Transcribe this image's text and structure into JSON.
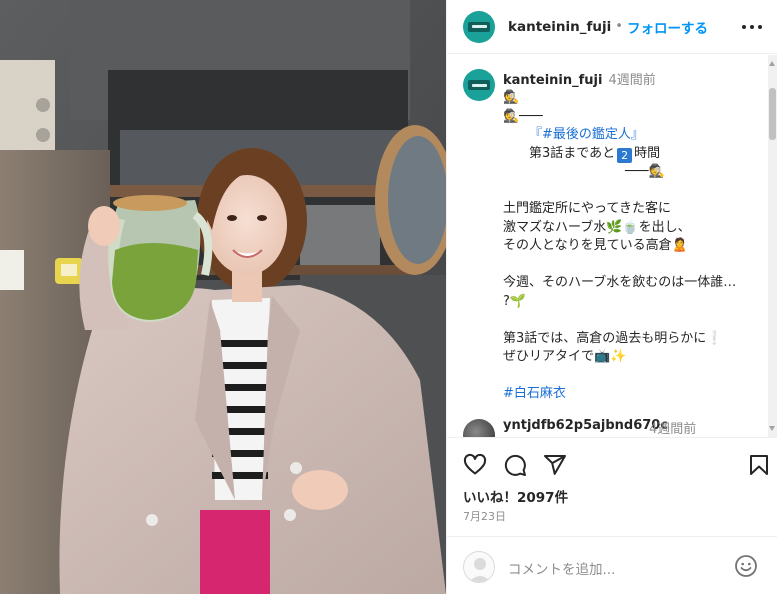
{
  "post": {
    "username": "kanteinin_fuji",
    "follow_separator": "•",
    "follow_label": "フォローする",
    "more_icon": "more-horizontal-icon"
  },
  "caption": {
    "username": "kanteinin_fuji",
    "time": "4週間前",
    "line1": "🕵",
    "line2": "🕵───",
    "line3_hashtag": "#最後の鑑定人",
    "line3_open": "『",
    "line3_close": "』",
    "line4_pre": "第3話まであと",
    "line4_key": "2",
    "line4_post": "時間",
    "line5": "───🕵",
    "para1_l1": "土門鑑定所にやってきた客に",
    "para1_l2a": "激マズなハーブ水",
    "para1_l2emo": "🌿🍵",
    "para1_l2b": "を出し、",
    "para1_l3": "その人となりを見ている高倉",
    "para1_l3emo": "🙎",
    "para2_l1": "今週、そのハーブ水を飲むのは一体誰…",
    "para2_l2": "?🌱",
    "para3_l1": "第3話では、高倉の過去も明らかに",
    "para3_l1emo": "❕",
    "para3_l2": "ぜひリアタイで",
    "para3_l2emo": "📺✨",
    "hashtag": "#白石麻衣"
  },
  "comment2": {
    "username": "yntjdfb62p5ajbnd670c",
    "time": "4週間前"
  },
  "actions": {
    "likes": "いいね！2097件",
    "date": "7月23日",
    "comment_placeholder": "コメントを追加...",
    "icons": [
      "heart-icon",
      "comment-icon",
      "share-icon",
      "bookmark-icon",
      "emoji-icon"
    ]
  },
  "colors": {
    "accent": "#0095f6",
    "link": "#00376b",
    "muted": "#8e8e8e",
    "logo": "#1aa29a"
  }
}
